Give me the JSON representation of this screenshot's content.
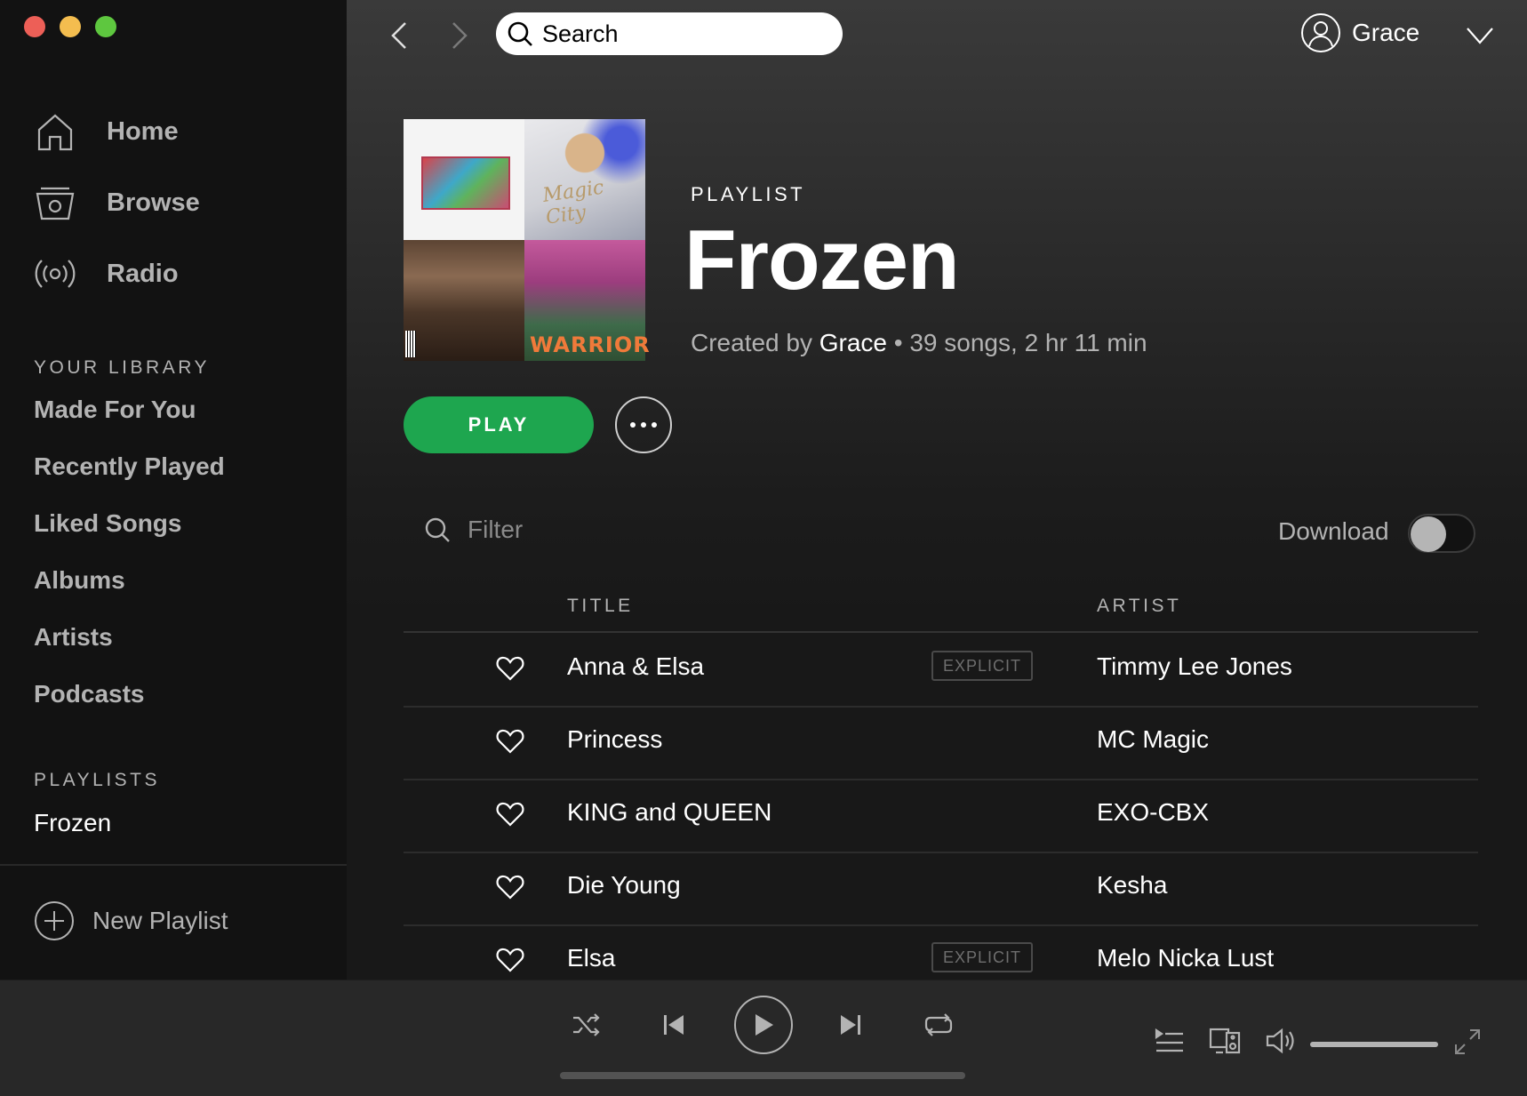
{
  "sidebar": {
    "nav": [
      {
        "label": "Home",
        "icon": "home-icon"
      },
      {
        "label": "Browse",
        "icon": "browse-icon"
      },
      {
        "label": "Radio",
        "icon": "radio-icon"
      }
    ],
    "library_title": "YOUR LIBRARY",
    "library": [
      "Made For You",
      "Recently Played",
      "Liked Songs",
      "Albums",
      "Artists",
      "Podcasts"
    ],
    "playlists_title": "PLAYLISTS",
    "playlists": [
      "Frozen"
    ],
    "new_playlist": "New Playlist"
  },
  "topbar": {
    "search_placeholder": "Search",
    "user_name": "Grace"
  },
  "playlist": {
    "type": "PLAYLIST",
    "title": "Frozen",
    "created_by_prefix": "Created by",
    "creator": "Grace",
    "stats": "• 39 songs, 2 hr 11 min",
    "play_label": "PLAY",
    "cover_texts": {
      "q2": "Magic City",
      "q4": "WARRIOR"
    }
  },
  "tracklist": {
    "filter_placeholder": "Filter",
    "download_label": "Download",
    "download_enabled": false,
    "columns": {
      "title": "TITLE",
      "artist": "ARTIST"
    },
    "explicit_label": "EXPLICIT",
    "tracks": [
      {
        "title": "Anna & Elsa",
        "artist": "Timmy Lee Jones",
        "explicit": true
      },
      {
        "title": "Princess",
        "artist": "MC Magic",
        "explicit": false
      },
      {
        "title": "KING and QUEEN",
        "artist": "EXO-CBX",
        "explicit": false
      },
      {
        "title": "Die Young",
        "artist": "Kesha",
        "explicit": false
      },
      {
        "title": "Elsa",
        "artist": "Melo Nicka Lust",
        "explicit": true
      }
    ]
  },
  "player": {
    "volume": 1.0,
    "progress": 0.0
  },
  "colors": {
    "accent_green": "#1ea64f",
    "sidebar_bg": "#121212",
    "main_bg": "#181818",
    "player_bg": "#282828"
  }
}
